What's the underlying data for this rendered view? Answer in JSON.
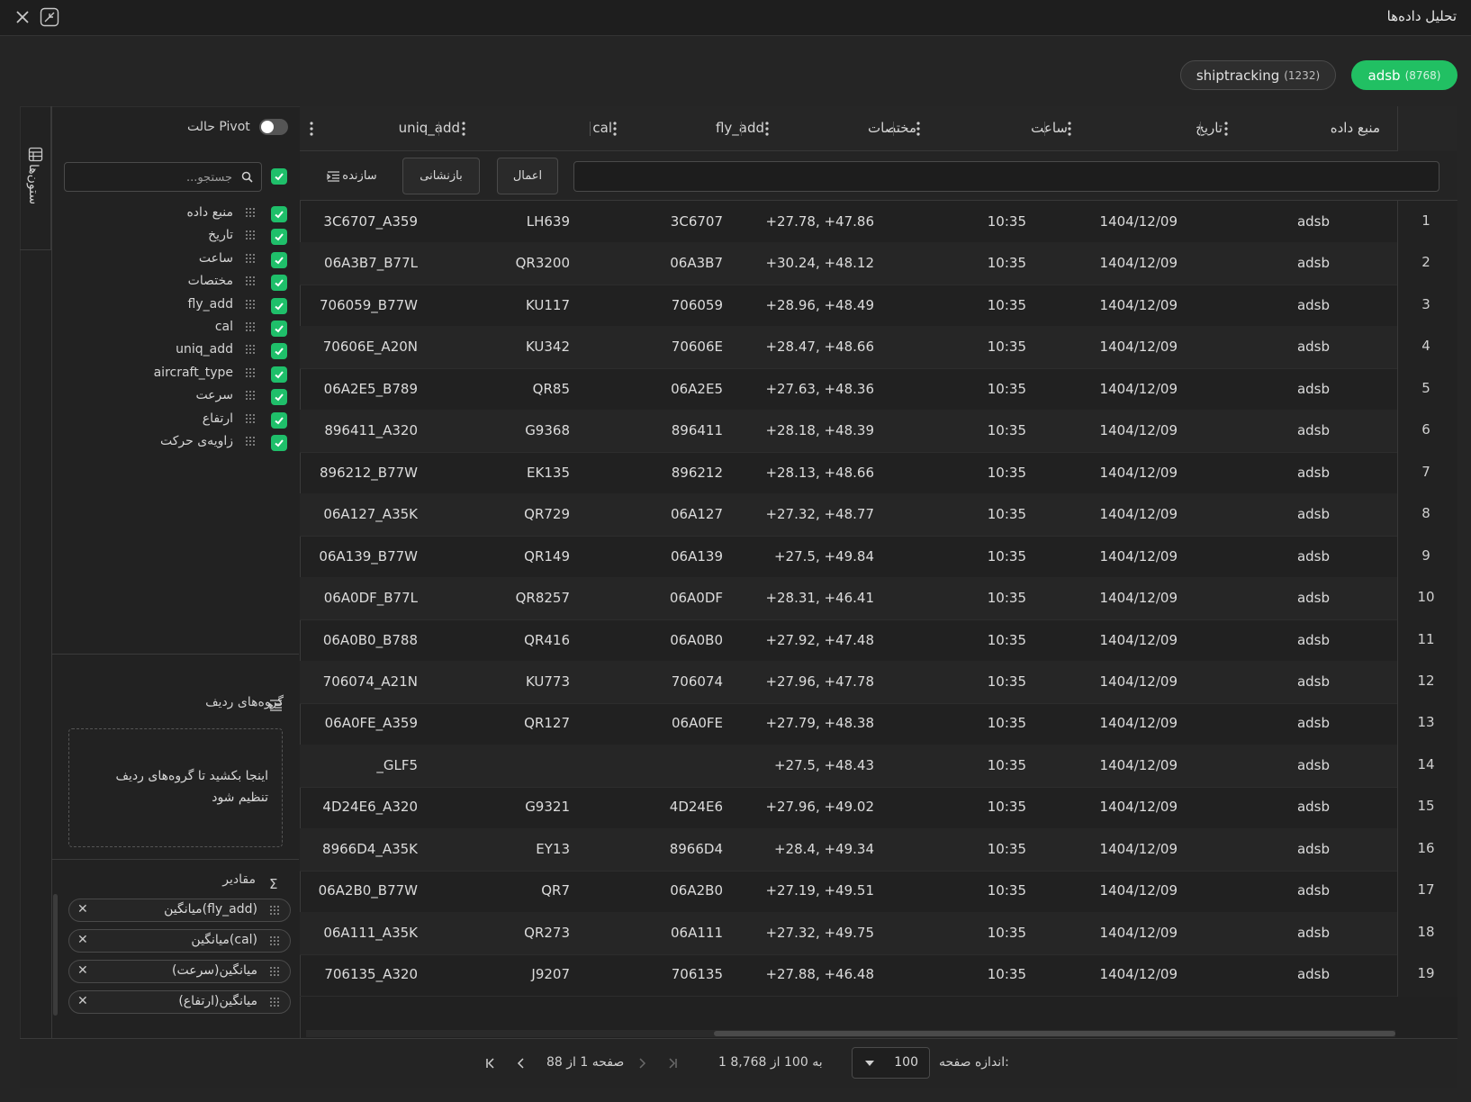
{
  "window": {
    "title": "تحلیل داده‌ها"
  },
  "sources": [
    {
      "name": "adsb",
      "count": "(8768)",
      "active": true
    },
    {
      "name": "shiptracking",
      "count": "(1232)",
      "active": false
    }
  ],
  "sidebar": {
    "vertical_tab_label": "ستون‌ها",
    "pivot_label": "حالت Pivot",
    "search_placeholder": "جستجو...",
    "columns": [
      "منبع داده",
      "تاریخ",
      "ساعت",
      "مختصات",
      "fly_add",
      "cal",
      "uniq_add",
      "aircraft_type",
      "سرعت",
      "ارتفاع",
      "زاویه‌ی حرکت"
    ],
    "row_groups_title": "گروه‌های ردیف",
    "row_groups_hint": "اینجا بکشید تا گروه‌های ردیف تنظیم شود",
    "values_title": "مقادیر",
    "values": [
      "میانگین(fly_add)",
      "میانگین(cal)",
      "میانگین(سرعت)",
      "میانگین(ارتفاع)"
    ]
  },
  "grid": {
    "headers": [
      "منبع داده",
      "تاریخ",
      "ساعت",
      "مختصات",
      "fly_add",
      "cal",
      "uniq_add"
    ],
    "filter": {
      "apply": "اعمال",
      "reset": "بازنشانی",
      "builder": "سازنده"
    },
    "rows": [
      [
        "1",
        "adsb",
        "1404/12/09",
        "10:35",
        "+27.78, +47.86",
        "3C6707",
        "LH639",
        "3C6707_A359"
      ],
      [
        "2",
        "adsb",
        "1404/12/09",
        "10:35",
        "+30.24, +48.12",
        "06A3B7",
        "QR3200",
        "06A3B7_B77L"
      ],
      [
        "3",
        "adsb",
        "1404/12/09",
        "10:35",
        "+28.96, +48.49",
        "706059",
        "KU117",
        "706059_B77W"
      ],
      [
        "4",
        "adsb",
        "1404/12/09",
        "10:35",
        "+28.47, +48.66",
        "70606E",
        "KU342",
        "70606E_A20N"
      ],
      [
        "5",
        "adsb",
        "1404/12/09",
        "10:35",
        "+27.63, +48.36",
        "06A2E5",
        "QR85",
        "06A2E5_B789"
      ],
      [
        "6",
        "adsb",
        "1404/12/09",
        "10:35",
        "+28.18, +48.39",
        "896411",
        "G9368",
        "896411_A320"
      ],
      [
        "7",
        "adsb",
        "1404/12/09",
        "10:35",
        "+28.13, +48.66",
        "896212",
        "EK135",
        "896212_B77W"
      ],
      [
        "8",
        "adsb",
        "1404/12/09",
        "10:35",
        "+27.32, +48.77",
        "06A127",
        "QR729",
        "06A127_A35K"
      ],
      [
        "9",
        "adsb",
        "1404/12/09",
        "10:35",
        "+27.5, +49.84",
        "06A139",
        "QR149",
        "06A139_B77W"
      ],
      [
        "10",
        "adsb",
        "1404/12/09",
        "10:35",
        "+28.31, +46.41",
        "06A0DF",
        "QR8257",
        "06A0DF_B77L"
      ],
      [
        "11",
        "adsb",
        "1404/12/09",
        "10:35",
        "+27.92, +47.48",
        "06A0B0",
        "QR416",
        "06A0B0_B788"
      ],
      [
        "12",
        "adsb",
        "1404/12/09",
        "10:35",
        "+27.96, +47.78",
        "706074",
        "KU773",
        "706074_A21N"
      ],
      [
        "13",
        "adsb",
        "1404/12/09",
        "10:35",
        "+27.79, +48.38",
        "06A0FE",
        "QR127",
        "06A0FE_A359"
      ],
      [
        "14",
        "adsb",
        "1404/12/09",
        "10:35",
        "+27.5, +48.43",
        "",
        "",
        "_GLF5"
      ],
      [
        "15",
        "adsb",
        "1404/12/09",
        "10:35",
        "+27.96, +49.02",
        "4D24E6",
        "G9321",
        "4D24E6_A320"
      ],
      [
        "16",
        "adsb",
        "1404/12/09",
        "10:35",
        "+28.4, +49.34",
        "8966D4",
        "EY13",
        "8966D4_A35K"
      ],
      [
        "17",
        "adsb",
        "1404/12/09",
        "10:35",
        "+27.19, +49.51",
        "06A2B0",
        "QR7",
        "06A2B0_B77W"
      ],
      [
        "18",
        "adsb",
        "1404/12/09",
        "10:35",
        "+27.32, +49.75",
        "06A111",
        "QR273",
        "06A111_A35K"
      ],
      [
        "19",
        "adsb",
        "1404/12/09",
        "10:35",
        "+27.88, +46.48",
        "706135",
        "J9207",
        "706135_A320"
      ]
    ]
  },
  "footer": {
    "page_size_label": "اندازه صفحه:",
    "page_size": "100",
    "range_text": "1 به 100 از 8,768",
    "page_text": "صفحه 1 از 88"
  },
  "colors": {
    "accent": "#21c063",
    "background": "#252525"
  }
}
